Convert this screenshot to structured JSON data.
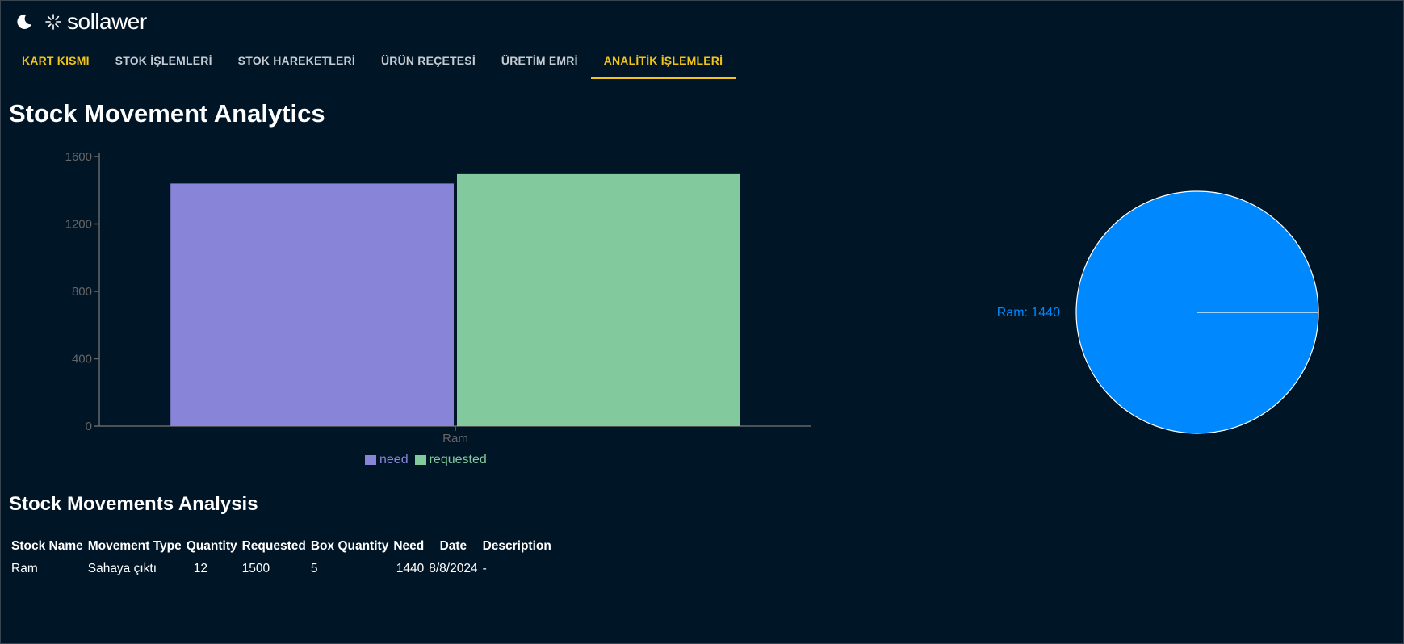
{
  "header": {
    "brand": "sollawer",
    "icons": {
      "theme_toggle": "moon-icon",
      "logo_mark": "sparkle-icon"
    }
  },
  "nav": {
    "tabs": [
      {
        "label": "KART KISMI",
        "color": "#f2c318"
      },
      {
        "label": "STOK İŞLEMLERİ"
      },
      {
        "label": "STOK HAREKETLERİ"
      },
      {
        "label": "ÜRÜN REÇETESİ"
      },
      {
        "label": "ÜRETİM EMRİ"
      },
      {
        "label": "ANALİTİK İŞLEMLERİ",
        "active": true,
        "color": "#f2c318"
      }
    ]
  },
  "page": {
    "title": "Stock Movement Analytics",
    "table_title": "Stock Movements Analysis"
  },
  "chart_data": [
    {
      "type": "bar",
      "categories": [
        "Ram"
      ],
      "series": [
        {
          "name": "need",
          "values": [
            1440
          ],
          "color": "#8884d8"
        },
        {
          "name": "requested",
          "values": [
            1500
          ],
          "color": "#82ca9d"
        }
      ],
      "yticks": [
        "0",
        "400",
        "800",
        "1200",
        "1600"
      ],
      "ylim": [
        0,
        1600
      ],
      "legend": "bottom-center",
      "grid": false
    },
    {
      "type": "pie",
      "slices": [
        {
          "label": "Ram: 1440",
          "name": "Ram",
          "value": 1440,
          "color": "#0088fe"
        }
      ]
    }
  ],
  "table": {
    "columns": [
      "Stock Name",
      "Movement Type",
      "Quantity",
      "Requested",
      "Box Quantity",
      "Need",
      "Date",
      "Description"
    ],
    "rows": [
      [
        "Ram",
        "Sahaya çıktı",
        "12",
        "1500",
        "5",
        "1440",
        "8/8/2024",
        "-"
      ]
    ]
  },
  "colors": {
    "background": "#001526",
    "accent": "#f2c318",
    "axis": "#666666",
    "tick_text": "#666666"
  }
}
